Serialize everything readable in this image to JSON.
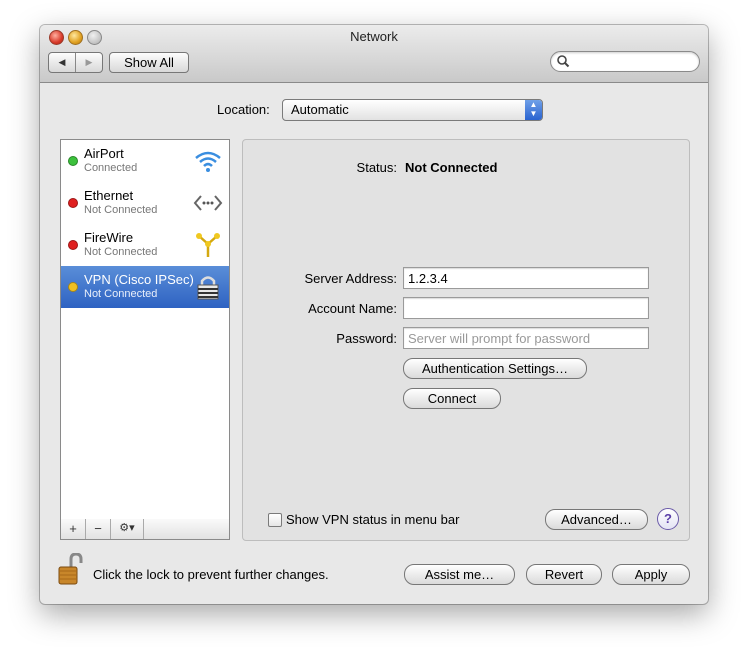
{
  "window": {
    "title": "Network"
  },
  "toolbar": {
    "back_label": "◀",
    "forward_label": "▶",
    "show_all_label": "Show All",
    "search_placeholder": ""
  },
  "location": {
    "label": "Location:",
    "value": "Automatic"
  },
  "services": [
    {
      "name": "AirPort",
      "status": "Connected",
      "dot_color": "#3cc13c",
      "icon": "airport-icon"
    },
    {
      "name": "Ethernet",
      "status": "Not Connected",
      "dot_color": "#e02020",
      "icon": "ethernet-icon"
    },
    {
      "name": "FireWire",
      "status": "Not Connected",
      "dot_color": "#e02020",
      "icon": "firewire-icon"
    },
    {
      "name": "VPN (Cisco IPSec)",
      "status": "Not Connected",
      "dot_color": "#f0c020",
      "icon": "vpn-lock-icon",
      "selected": true
    }
  ],
  "sidebar_toolbar": {
    "add": "+",
    "remove": "−",
    "action": "⚙▾"
  },
  "detail": {
    "status_label": "Status:",
    "status_value": "Not Connected",
    "server_label": "Server Address:",
    "server_value": "1.2.3.4",
    "account_label": "Account Name:",
    "account_value": "",
    "password_label": "Password:",
    "password_placeholder": "Server will prompt for password",
    "auth_button": "Authentication Settings…",
    "connect_button": "Connect",
    "show_status_label": "Show VPN status in menu bar",
    "advanced_button": "Advanced…",
    "help_label": "?"
  },
  "footer": {
    "lock_text": "Click the lock to prevent further changes.",
    "assist": "Assist me…",
    "revert": "Revert",
    "apply": "Apply"
  }
}
